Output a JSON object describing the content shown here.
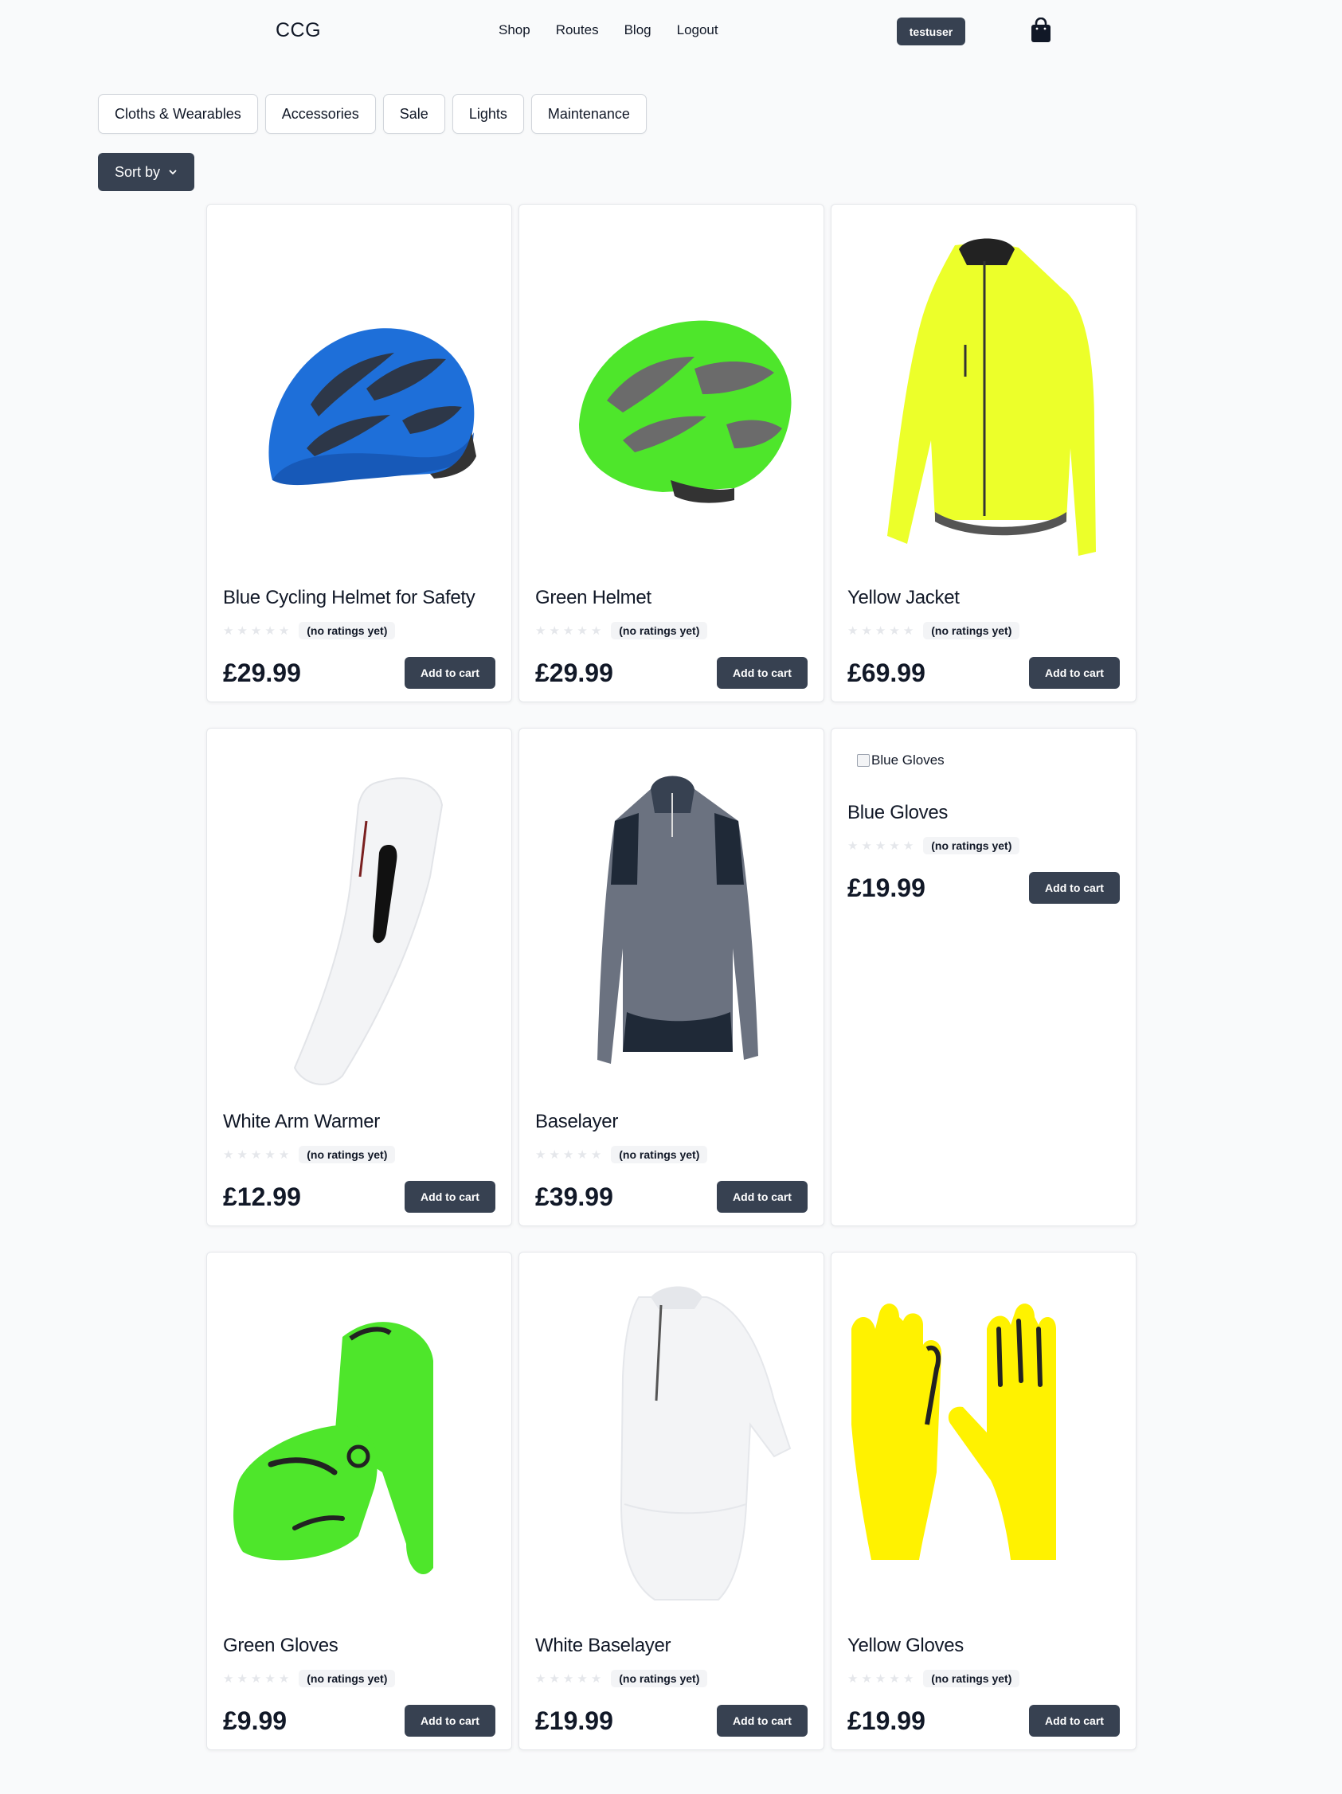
{
  "header": {
    "logo": "CCG",
    "nav": [
      "Shop",
      "Routes",
      "Blog",
      "Logout"
    ],
    "user": "testuser",
    "cart_icon": "shopping-bag-icon"
  },
  "filters": [
    "Cloths & Wearables",
    "Accessories",
    "Sale",
    "Lights",
    "Maintenance"
  ],
  "sort": {
    "label": "Sort by",
    "icon": "chevron-down-icon"
  },
  "products": [
    {
      "name": "Blue Cycling Helmet for Safety",
      "rating_text": "(no ratings yet)",
      "price": "£29.99",
      "button": "Add to cart"
    },
    {
      "name": "Green Helmet",
      "rating_text": "(no ratings yet)",
      "price": "£29.99",
      "button": "Add to cart"
    },
    {
      "name": "Yellow Jacket",
      "rating_text": "(no ratings yet)",
      "price": "£69.99",
      "button": "Add to cart"
    },
    {
      "name": "White Arm Warmer",
      "rating_text": "(no ratings yet)",
      "price": "£12.99",
      "button": "Add to cart"
    },
    {
      "name": "Baselayer",
      "rating_text": "(no ratings yet)",
      "price": "£39.99",
      "button": "Add to cart"
    },
    {
      "name": "Blue Gloves",
      "image_alt": "Blue Gloves",
      "rating_text": "(no ratings yet)",
      "price": "£19.99",
      "button": "Add to cart"
    },
    {
      "name": "Green Gloves",
      "rating_text": "(no ratings yet)",
      "price": "£9.99",
      "button": "Add to cart"
    },
    {
      "name": "White Baselayer",
      "rating_text": "(no ratings yet)",
      "price": "£19.99",
      "button": "Add to cart"
    },
    {
      "name": "Yellow Gloves",
      "rating_text": "(no ratings yet)",
      "price": "£19.99",
      "button": "Add to cart"
    }
  ],
  "colors": {
    "primary_dark": "#374151",
    "background": "#f9fafb",
    "blue_helmet": "#1e6fd9",
    "green": "#4ee62b",
    "yellow": "#f6ff1f"
  }
}
